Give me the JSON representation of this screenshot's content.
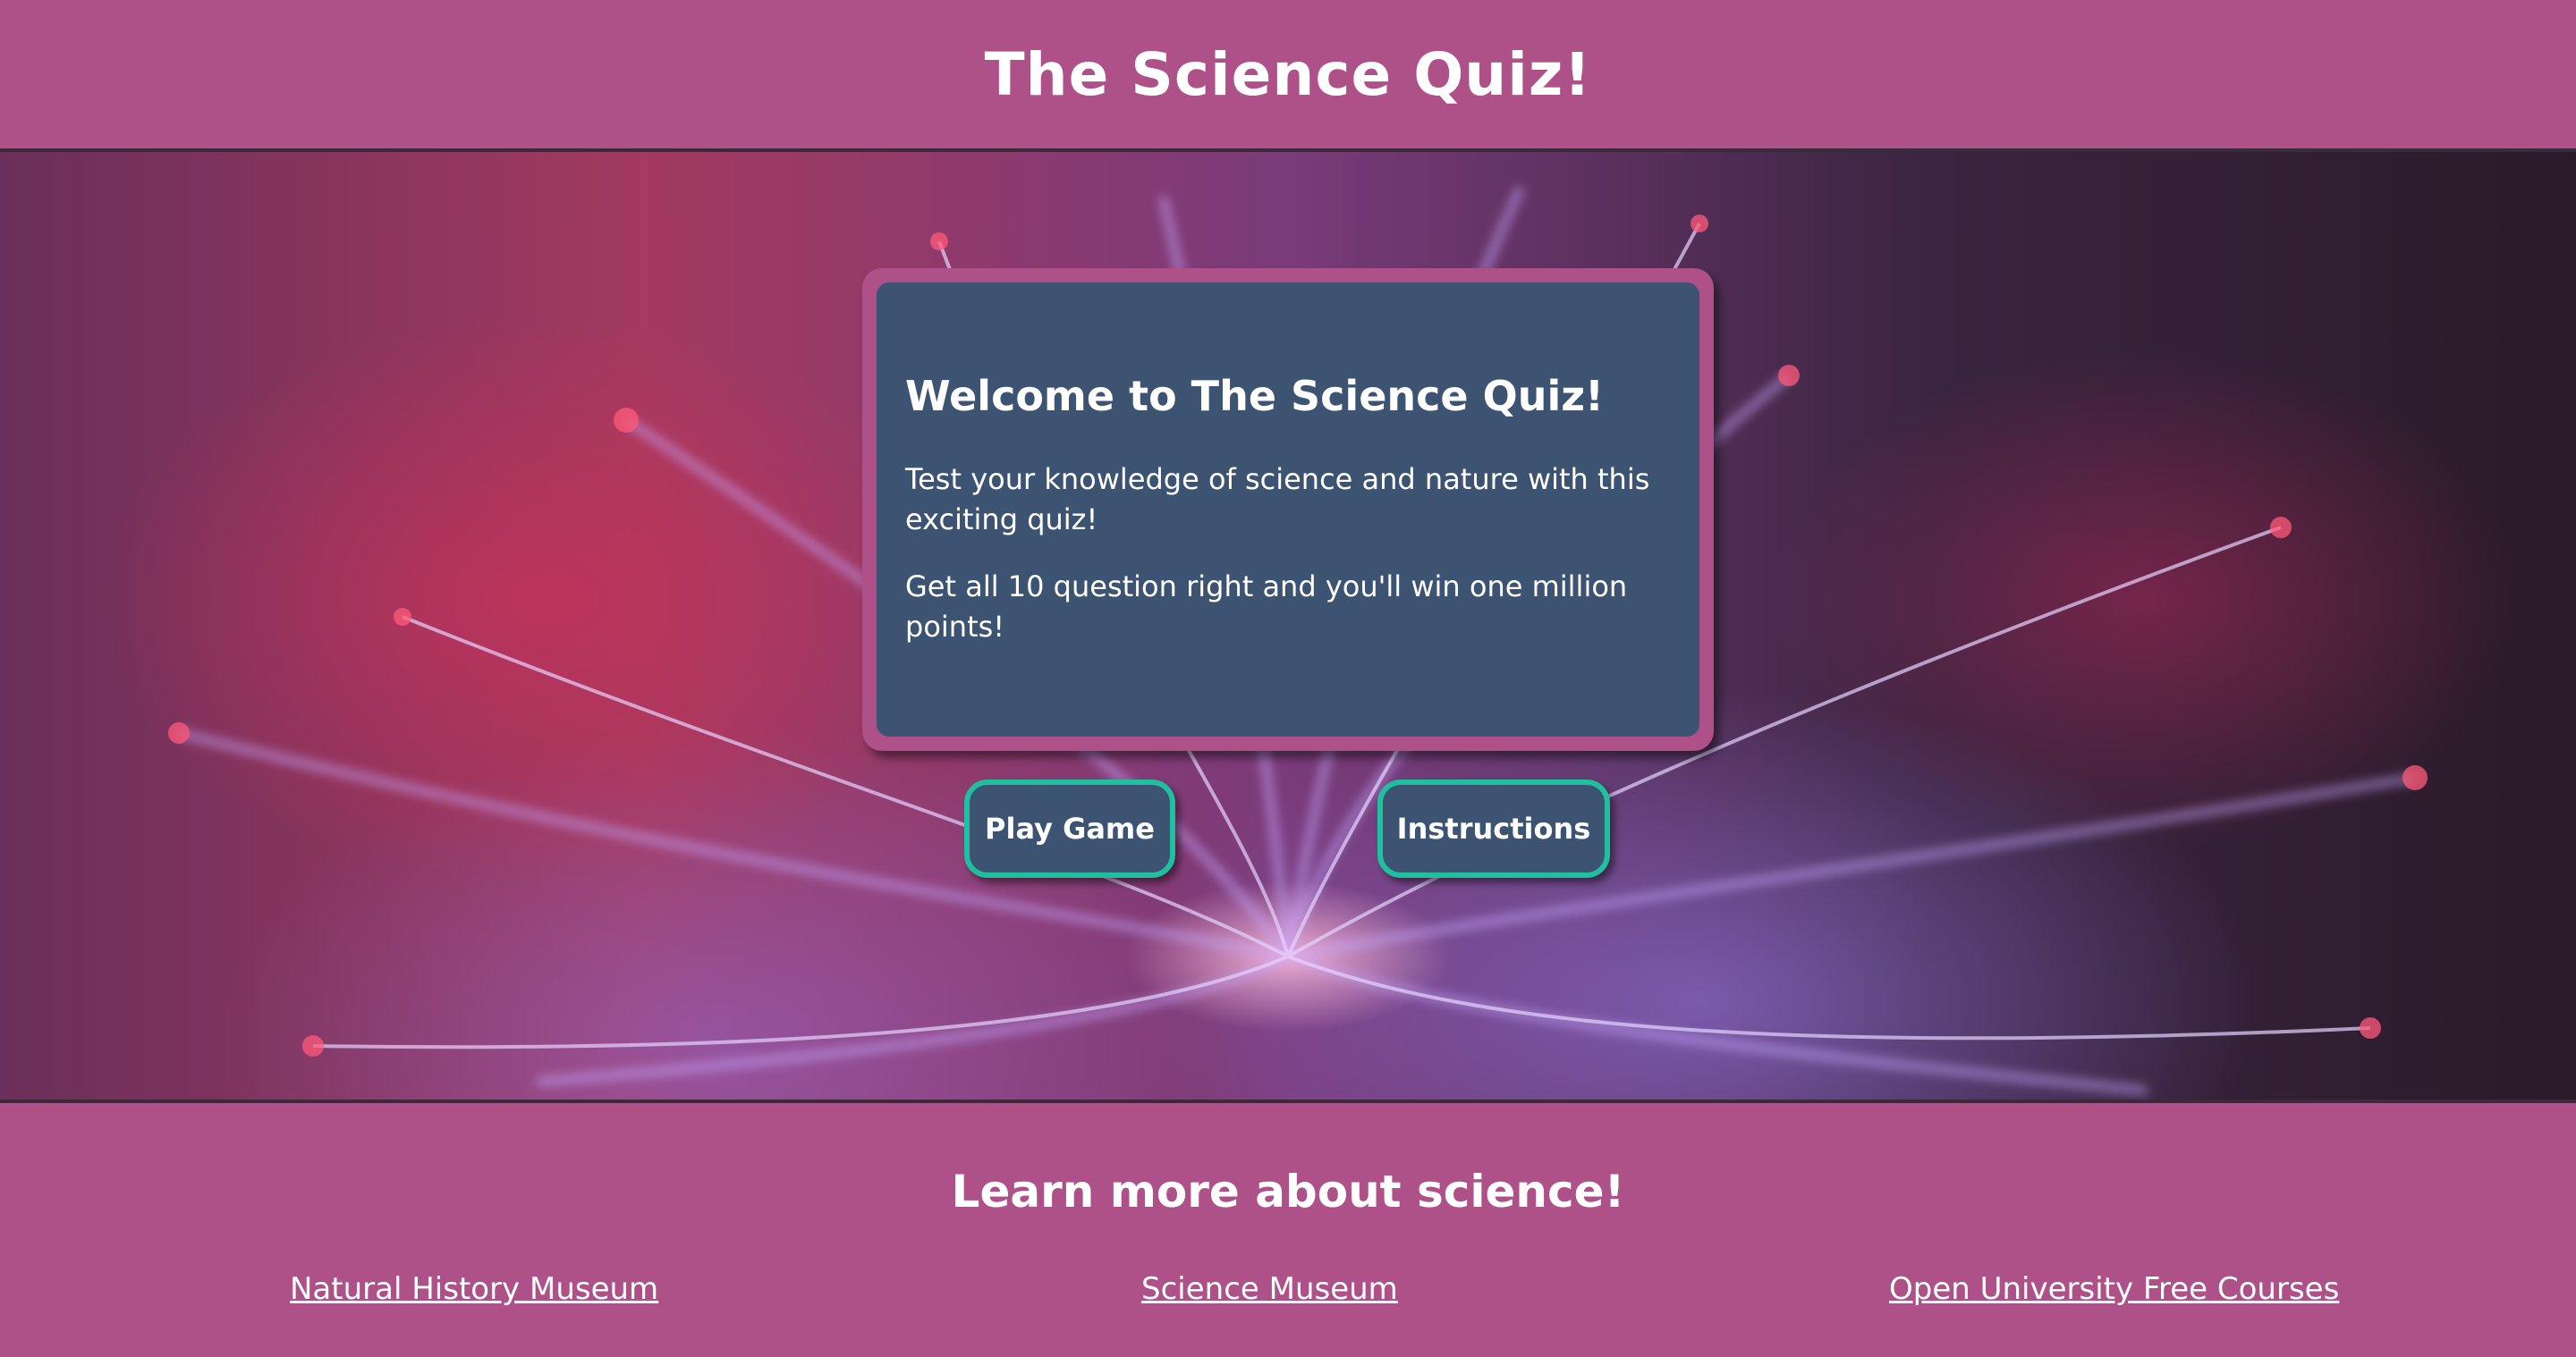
{
  "header": {
    "title": "The Science Quiz!"
  },
  "welcome": {
    "heading": "Welcome to The Science Quiz!",
    "paragraphs": [
      "Test your knowledge of science and nature with this exciting quiz!",
      "Get all 10 question right and you'll win one million points!"
    ]
  },
  "buttons": {
    "play_label": "Play Game",
    "instructions_label": "Instructions"
  },
  "footer": {
    "heading": "Learn more about science!",
    "links": [
      {
        "label": "Natural History Museum"
      },
      {
        "label": "Science Museum"
      },
      {
        "label": "Open University Free Courses"
      }
    ]
  },
  "colors": {
    "page_background": "#ae5189",
    "card_background": "#3d5372",
    "button_border": "#1fbfa0",
    "text": "#ffffff"
  },
  "hero": {
    "image": "plasma-ball-background"
  }
}
